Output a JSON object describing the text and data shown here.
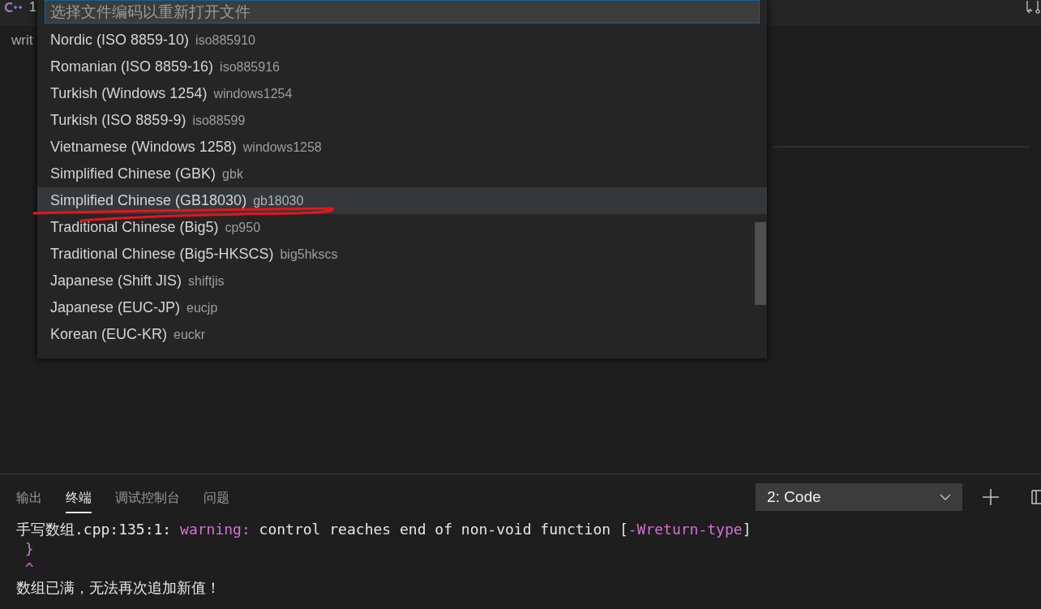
{
  "editor": {
    "tab_label": "1",
    "breadcrumb": "writ"
  },
  "quick_pick": {
    "placeholder": "选择文件编码以重新打开文件",
    "items": [
      {
        "label": "Nordic (ISO 8859-10)",
        "description": "iso885910",
        "selected": false
      },
      {
        "label": "Romanian (ISO 8859-16)",
        "description": "iso885916",
        "selected": false
      },
      {
        "label": "Turkish (Windows 1254)",
        "description": "windows1254",
        "selected": false
      },
      {
        "label": "Turkish (ISO 8859-9)",
        "description": "iso88599",
        "selected": false
      },
      {
        "label": "Vietnamese (Windows 1258)",
        "description": "windows1258",
        "selected": false
      },
      {
        "label": "Simplified Chinese (GBK)",
        "description": "gbk",
        "selected": false
      },
      {
        "label": "Simplified Chinese (GB18030)",
        "description": "gb18030",
        "selected": true
      },
      {
        "label": "Traditional Chinese (Big5)",
        "description": "cp950",
        "selected": false
      },
      {
        "label": "Traditional Chinese (Big5-HKSCS)",
        "description": "big5hkscs",
        "selected": false
      },
      {
        "label": "Japanese (Shift JIS)",
        "description": "shiftjis",
        "selected": false
      },
      {
        "label": "Japanese (EUC-JP)",
        "description": "eucjp",
        "selected": false
      },
      {
        "label": "Korean (EUC-KR)",
        "description": "euckr",
        "selected": false
      }
    ]
  },
  "panel": {
    "tabs": [
      {
        "label": "输出",
        "selected": false
      },
      {
        "label": "终端",
        "selected": true
      },
      {
        "label": "调试控制台",
        "selected": false
      },
      {
        "label": "问题",
        "selected": false
      }
    ],
    "terminal_select": "2: Code",
    "terminal_lines": [
      [
        {
          "text": "手写数组.cpp:135:1: ",
          "kind": "normal"
        },
        {
          "text": "warning:",
          "kind": "accent"
        },
        {
          "text": " control reaches end of non-void function [",
          "kind": "normal"
        },
        {
          "text": "-Wreturn-type",
          "kind": "accent"
        },
        {
          "text": "]",
          "kind": "normal"
        }
      ],
      [
        {
          "text": " }",
          "kind": "accent"
        }
      ],
      [
        {
          "text": " ^",
          "kind": "accent"
        }
      ],
      [
        {
          "text": "数组已满，无法再次追加新值！",
          "kind": "normal"
        }
      ]
    ]
  }
}
